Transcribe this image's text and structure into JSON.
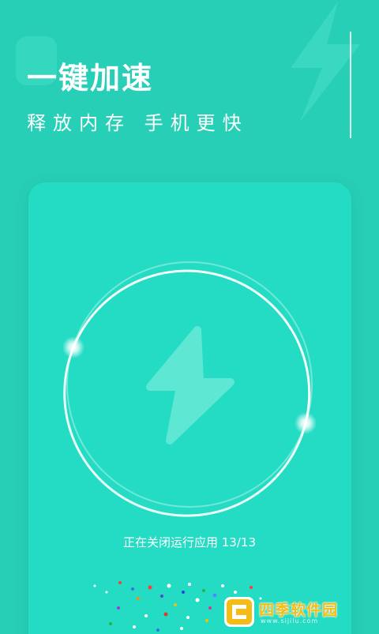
{
  "header": {
    "title": "一键加速",
    "subtitle": "释放内存  手机更快"
  },
  "boost_card": {
    "icon": "lightning-bolt-icon",
    "status_text": "正在关闭运行应用 13/13"
  },
  "watermark": {
    "text": "四季软件园",
    "sub": "www.sijilu.com"
  },
  "colors": {
    "background": "#27cfb6",
    "card": "#24dcc4",
    "ring": "#ffffff",
    "bolt": "#5ee8d4",
    "watermark": "#f4bc14"
  }
}
